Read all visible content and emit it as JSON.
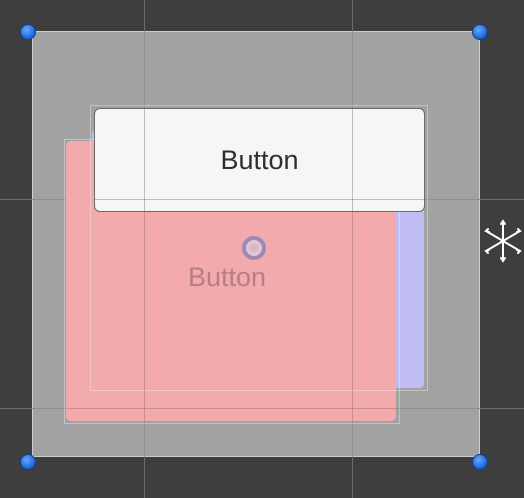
{
  "scene": {
    "button_label": "Button",
    "ghost_button_label": "Button",
    "colors": {
      "background": "#3e3e3e",
      "panel": "#a2a2a2",
      "ghost_red": "#f2aaac",
      "ghost_blue": "#c0bdf3",
      "button_face": "#f6f6f6",
      "handle": "#1a63d6"
    },
    "icons": {
      "corner_handles": "resize-handle-icon",
      "pivot": "pivot-icon",
      "anchor": "anchor-icon"
    }
  }
}
